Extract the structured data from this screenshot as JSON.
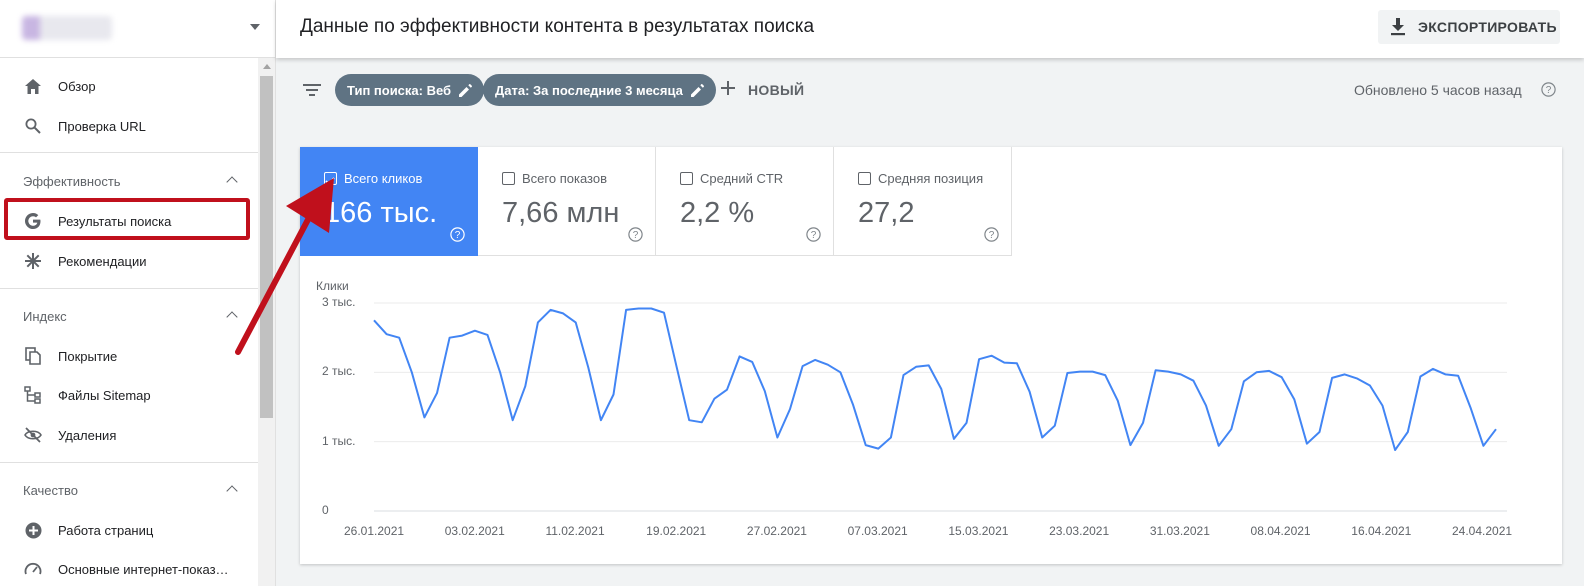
{
  "header": {
    "title": "Данные по эффективности контента в результатах поиска",
    "export_label": "ЭКСПОРТИРОВАТЬ"
  },
  "sidebar": {
    "items_top": [
      {
        "label": "Обзор",
        "icon": "home-icon"
      },
      {
        "label": "Проверка URL",
        "icon": "search-icon"
      }
    ],
    "sections": [
      {
        "label": "Эффективность",
        "items": [
          {
            "label": "Результаты поиска",
            "icon": "google-g-icon",
            "highlighted": true
          },
          {
            "label": "Рекомендации",
            "icon": "asterisk-icon"
          }
        ]
      },
      {
        "label": "Индекс",
        "items": [
          {
            "label": "Покрытие",
            "icon": "pages-icon"
          },
          {
            "label": "Файлы Sitemap",
            "icon": "sitemap-icon"
          },
          {
            "label": "Удаления",
            "icon": "eye-off-icon"
          }
        ]
      },
      {
        "label": "Качество",
        "items": [
          {
            "label": "Работа страниц",
            "icon": "plus-circle-icon"
          },
          {
            "label": "Основные интернет-показ…",
            "icon": "gauge-icon"
          }
        ]
      }
    ]
  },
  "filters": {
    "chips": [
      "Тип поиска: Веб",
      "Дата: За последние 3 месяца"
    ],
    "new_label": "НОВЫЙ",
    "updated": "Обновлено 5 часов назад"
  },
  "metrics": [
    {
      "label": "Всего кликов",
      "value": "166 тыс.",
      "checked": true
    },
    {
      "label": "Всего показов",
      "value": "7,66 млн",
      "checked": false
    },
    {
      "label": "Средний CTR",
      "value": "2,2 %",
      "checked": false
    },
    {
      "label": "Средняя позиция",
      "value": "27,2",
      "checked": false
    }
  ],
  "colors": {
    "accent": "#4285f4",
    "chip": "#5f7383",
    "highlight": "#c0101c"
  },
  "chart_data": {
    "type": "line",
    "ylabel": "Клики",
    "ylim": [
      0,
      3000
    ],
    "ytick_labels": [
      "3 тыс.",
      "2 тыс.",
      "1 тыс.",
      "0"
    ],
    "yticks": [
      3000,
      2000,
      1000,
      0
    ],
    "x_tick_labels": [
      "26.01.2021",
      "03.02.2021",
      "11.02.2021",
      "19.02.2021",
      "27.02.2021",
      "07.03.2021",
      "15.03.2021",
      "23.03.2021",
      "31.03.2021",
      "08.04.2021",
      "16.04.2021",
      "24.04.2021"
    ],
    "x_start": "2021-01-26",
    "x_end": "2021-04-24",
    "color": "#4285f4",
    "series": [
      {
        "values": [
          2750,
          2550,
          2500,
          2000,
          1350,
          1700,
          2500,
          2530,
          2600,
          2540,
          2000,
          1310,
          1800,
          2720,
          2900,
          2850,
          2720,
          2070,
          1310,
          1680,
          2900,
          2920,
          2920,
          2860,
          2080,
          1310,
          1280,
          1620,
          1750,
          2230,
          2150,
          1730,
          1060,
          1470,
          2090,
          2180,
          2110,
          2000,
          1530,
          950,
          900,
          1060,
          1960,
          2080,
          2100,
          1760,
          1040,
          1270,
          2190,
          2240,
          2140,
          2130,
          1720,
          1060,
          1230,
          1990,
          2010,
          2010,
          1960,
          1590,
          950,
          1270,
          2030,
          2010,
          1970,
          1880,
          1520,
          940,
          1180,
          1870,
          2000,
          2020,
          1930,
          1610,
          970,
          1140,
          1920,
          1970,
          1910,
          1810,
          1520,
          880,
          1140,
          1940,
          2050,
          1970,
          1950,
          1480,
          940,
          1180
        ]
      }
    ]
  }
}
